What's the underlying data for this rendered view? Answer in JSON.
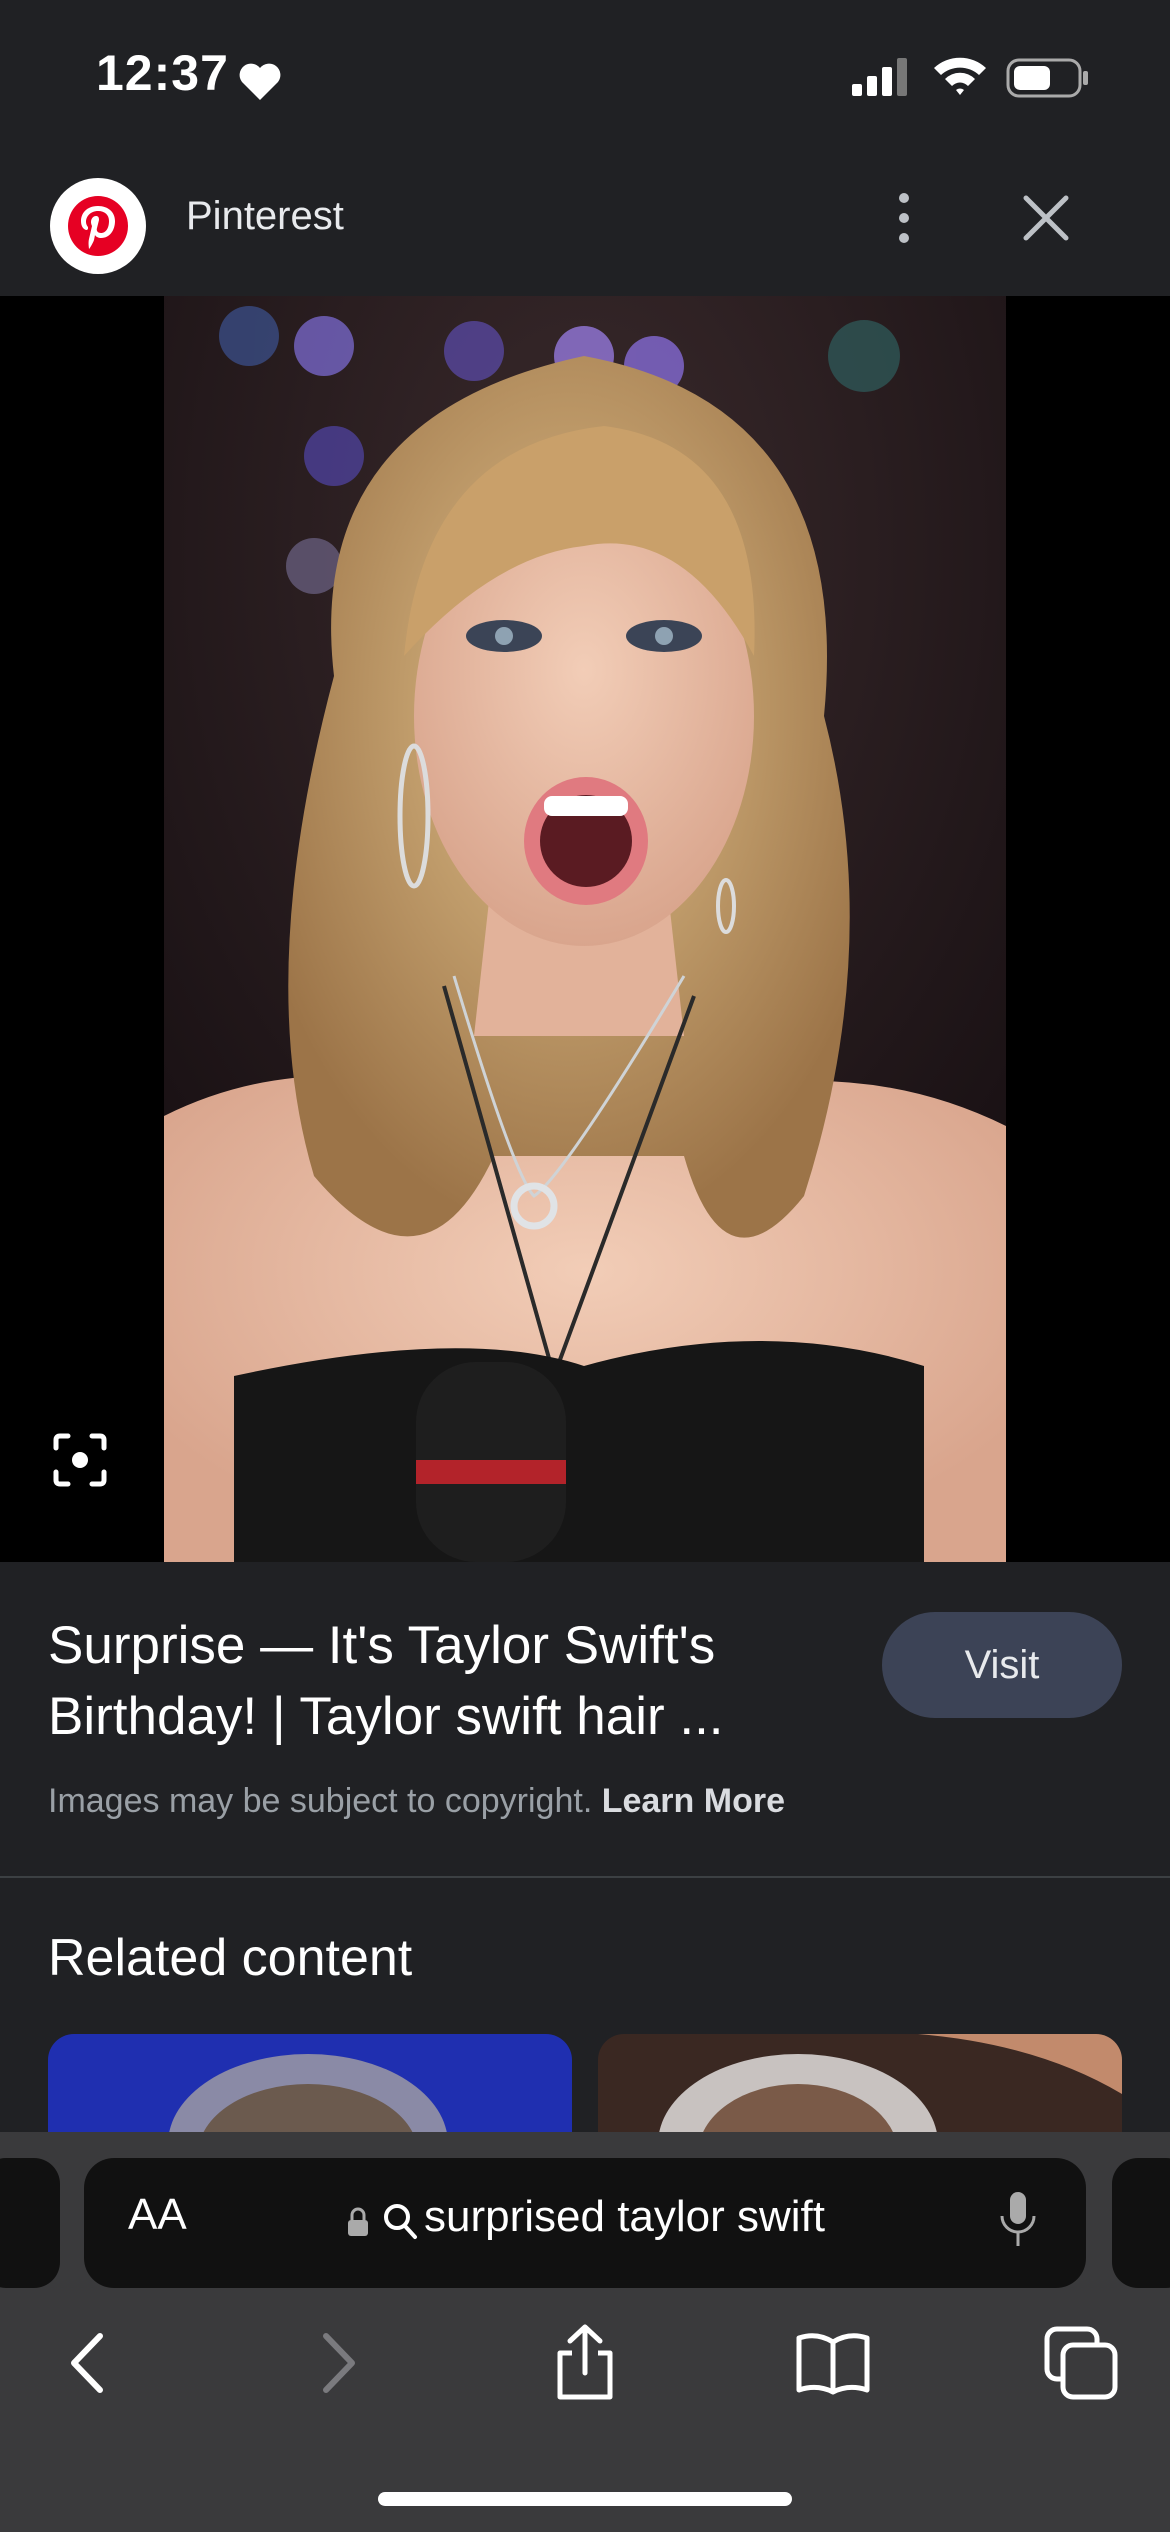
{
  "status_bar": {
    "time": "12:37"
  },
  "source": {
    "name": "Pinterest"
  },
  "result": {
    "title": "Surprise — It's Taylor Swift's Birthday! | Taylor swift hair ...",
    "visit_label": "Visit",
    "copyright_text": "Images may be subject to copyright.",
    "learn_more_label": "Learn More"
  },
  "related": {
    "heading": "Related content"
  },
  "address_bar": {
    "text_size_label": "AA",
    "query": "surprised taylor swift"
  },
  "icons": {
    "brand": "pinterest-logo",
    "more": "more-vert-icon",
    "close": "close-icon",
    "lens": "google-lens-icon",
    "lock": "lock-icon",
    "search": "search-icon",
    "mic": "microphone-icon",
    "back": "back-chevron-icon",
    "forward": "forward-chevron-icon",
    "share": "share-icon",
    "bookmarks": "bookmarks-icon",
    "tabs": "tabs-icon"
  },
  "colors": {
    "background": "#202124",
    "visit_button": "#3c4356",
    "pinterest_red": "#e60023"
  }
}
